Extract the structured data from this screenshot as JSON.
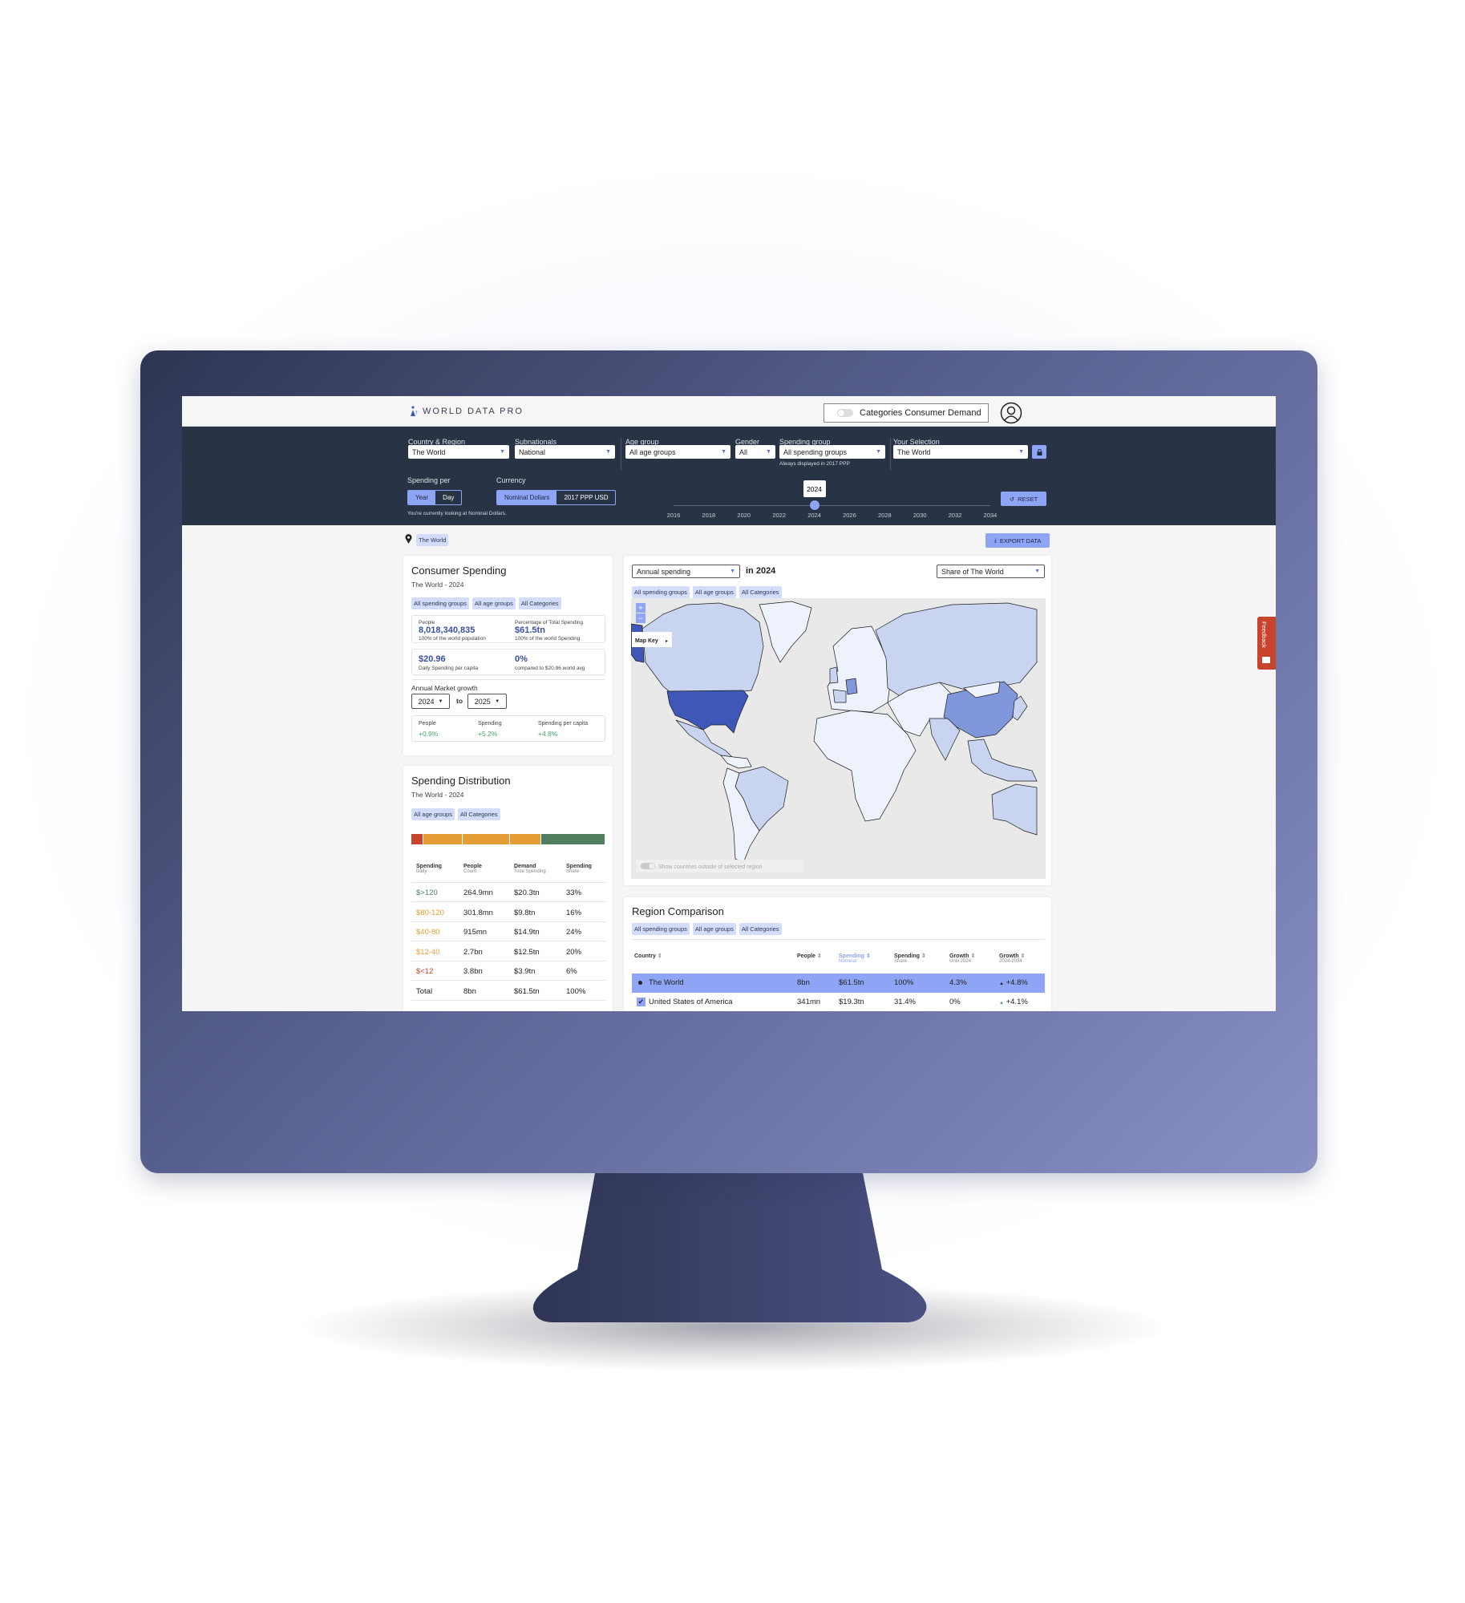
{
  "app": {
    "title": "WORLD DATA PRO",
    "mode_toggle": "Categories Consumer Demand"
  },
  "filters": {
    "country": {
      "label": "Country & Region",
      "value": "The World"
    },
    "subnationals": {
      "label": "Subnationals",
      "value": "National"
    },
    "age": {
      "label": "Age group",
      "value": "All age groups"
    },
    "gender": {
      "label": "Gender",
      "value": "All"
    },
    "spending_group": {
      "label": "Spending group",
      "value": "All spending groups",
      "note": "Always displayed in 2017 PPP"
    },
    "selection": {
      "label": "Your Selection",
      "value": "The World"
    },
    "spending_per": {
      "label": "Spending per",
      "options": [
        "Year",
        "Day"
      ],
      "selected": "Year"
    },
    "currency": {
      "label": "Currency",
      "options": [
        "Nominal Dollars",
        "2017 PPP USD"
      ],
      "selected": "Nominal Dollars",
      "note": "You're currently looking at Nominal Dollars."
    },
    "timeline": {
      "ticks": [
        "2016",
        "2018",
        "2020",
        "2022",
        "2024",
        "2026",
        "2028",
        "2030",
        "2032",
        "2034"
      ],
      "selected": "2024",
      "min": 2016,
      "max": 2034,
      "value": 2024
    },
    "reset_label": "RESET"
  },
  "location": {
    "chip": "The World",
    "export_label": "EXPORT DATA"
  },
  "consumer_spending": {
    "title": "Consumer Spending",
    "subtitle": "The World - 2024",
    "chips": [
      "All spending groups",
      "All age groups",
      "All Categories"
    ],
    "people": {
      "label": "People",
      "value": "8,018,340,835",
      "note": "100% of the world population"
    },
    "pct": {
      "label": "Percentage of Total Spending",
      "value": "$61.5tn",
      "note": "100% of the world Spending"
    },
    "daily": {
      "value": "$20.96",
      "note": "Daily Spending per capita"
    },
    "compare": {
      "value": "0%",
      "note": "compared to $20.96 world avg"
    },
    "growth": {
      "label": "Annual Market growth",
      "from": "2024",
      "to_label": "to",
      "to": "2025",
      "items": [
        {
          "label": "People",
          "value": "+0.9%"
        },
        {
          "label": "Spending",
          "value": "+5.2%"
        },
        {
          "label": "Spending per capita",
          "value": "+4.8%"
        }
      ]
    }
  },
  "distribution": {
    "title": "Spending Distribution",
    "subtitle": "The World - 2024",
    "chips": [
      "All age groups",
      "All Categories"
    ],
    "bar": [
      {
        "share": 6,
        "color": "#c8442c"
      },
      {
        "share": 20,
        "color": "#e59d35"
      },
      {
        "share": 24,
        "color": "#e59d35"
      },
      {
        "share": 16,
        "color": "#e59d35"
      },
      {
        "share": 33,
        "color": "#4f7f5f"
      }
    ],
    "headers": [
      {
        "t": "Spending",
        "s": "Daily"
      },
      {
        "t": "People",
        "s": "Count"
      },
      {
        "t": "Demand",
        "s": "Total Spending"
      },
      {
        "t": "Spending",
        "s": "Share"
      }
    ],
    "rows": [
      {
        "range": "$>120",
        "people": "264.9mn",
        "demand": "$20.3tn",
        "share": "33%",
        "color": "#4f7f5f"
      },
      {
        "range": "$80-120",
        "people": "301.8mn",
        "demand": "$9.8tn",
        "share": "16%",
        "color": "#e59d35"
      },
      {
        "range": "$40-80",
        "people": "915mn",
        "demand": "$14.9tn",
        "share": "24%",
        "color": "#e59d35"
      },
      {
        "range": "$12-40",
        "people": "2.7bn",
        "demand": "$12.5tn",
        "share": "20%",
        "color": "#e59d35"
      },
      {
        "range": "$<12",
        "people": "3.8bn",
        "demand": "$3.9tn",
        "share": "6%",
        "color": "#c8442c"
      },
      {
        "range": "Total",
        "people": "8bn",
        "demand": "$61.5tn",
        "share": "100%",
        "color": "#222222"
      }
    ]
  },
  "map": {
    "metric": "Annual spending",
    "year_label": "in 2024",
    "share": "Share of The World",
    "chips": [
      "All spending groups",
      "All age groups",
      "All Categories"
    ],
    "key_label": "Map Key",
    "toggle_label": "Show countries outside of selected region",
    "zoom_in": "+",
    "zoom_out": "−",
    "colors": {
      "ocean": "#e9e9e9",
      "low": "#eef2fc",
      "mid": "#c9d5f0",
      "high": "#8197dc",
      "top": "#3f58b8"
    }
  },
  "region": {
    "title": "Region Comparison",
    "chips": [
      "All spending groups",
      "All age groups",
      "All Categories"
    ],
    "headers": [
      {
        "t": "Country",
        "s": ""
      },
      {
        "t": "People",
        "s": ""
      },
      {
        "t": "Spending",
        "s": "Nominal"
      },
      {
        "t": "Spending",
        "s": "Share"
      },
      {
        "t": "Growth",
        "s": "Until 2024"
      },
      {
        "t": "Growth",
        "s": "2024-2034"
      }
    ],
    "rows": [
      {
        "country": "The World",
        "people": "8bn",
        "spending": "$61.5tn",
        "share": "100%",
        "growth": "4.3%",
        "growth2": "+4.8%"
      },
      {
        "country": "United States of America",
        "people": "341mn",
        "spending": "$19.3tn",
        "share": "31.4%",
        "growth": "0%",
        "growth2": "+4.1%"
      }
    ]
  },
  "feedback": "Feedback"
}
